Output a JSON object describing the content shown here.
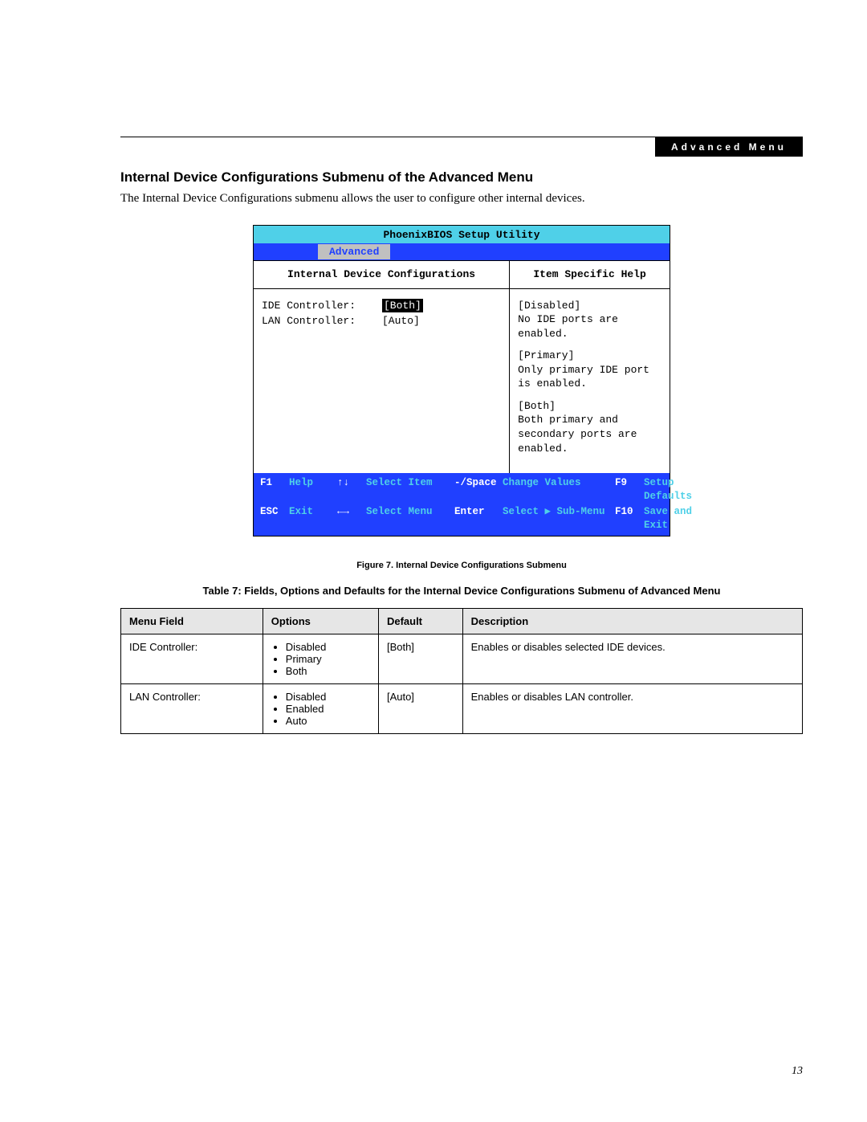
{
  "header": {
    "tab": "Advanced Menu"
  },
  "section": {
    "title": "Internal Device Configurations Submenu of the Advanced Menu",
    "intro": "The Internal Device Configurations submenu allows the user to configure other internal devices."
  },
  "bios": {
    "app_title": "PhoenixBIOS Setup Utility",
    "active_tab": "Advanced",
    "left_header": "Internal Device Configurations",
    "right_header": "Item Specific Help",
    "fields": [
      {
        "label": "IDE Controller:",
        "value": "[Both]",
        "selected": true
      },
      {
        "label": "LAN Controller:",
        "value": "[Auto]",
        "selected": false
      }
    ],
    "help": [
      {
        "title": "[Disabled]",
        "body": "No IDE ports are enabled."
      },
      {
        "title": "[Primary]",
        "body": "Only primary IDE port is enabled."
      },
      {
        "title": "[Both]",
        "body": "Both primary and secondary ports are enabled."
      }
    ],
    "footer": {
      "f1_key": "F1",
      "f1_lbl": "Help",
      "ud_key": "↑↓",
      "ud_lbl": "Select Item",
      "pm_key": "-/Space",
      "pm_lbl": "Change Values",
      "f9_key": "F9",
      "f9_lbl": "Setup Defaults",
      "esc_key": "ESC",
      "esc_lbl": "Exit",
      "lr_key": "←→",
      "lr_lbl": "Select Menu",
      "ent_key": "Enter",
      "ent_lbl": "Select ▶ Sub-Menu",
      "f10_key": "F10",
      "f10_lbl": "Save and Exit"
    }
  },
  "figure_caption": "Figure 7.  Internal Device Configurations Submenu",
  "table": {
    "caption": "Table 7: Fields, Options and Defaults for the Internal Device Configurations Submenu of Advanced Menu",
    "headers": {
      "c1": "Menu Field",
      "c2": "Options",
      "c3": "Default",
      "c4": "Description"
    },
    "rows": [
      {
        "field": "IDE Controller:",
        "options": [
          "Disabled",
          "Primary",
          "Both"
        ],
        "default": "[Both]",
        "description": "Enables or disables selected IDE devices."
      },
      {
        "field": "LAN Controller:",
        "options": [
          "Disabled",
          "Enabled",
          "Auto"
        ],
        "default": "[Auto]",
        "description": "Enables or disables LAN controller."
      }
    ]
  },
  "page_number": "13"
}
